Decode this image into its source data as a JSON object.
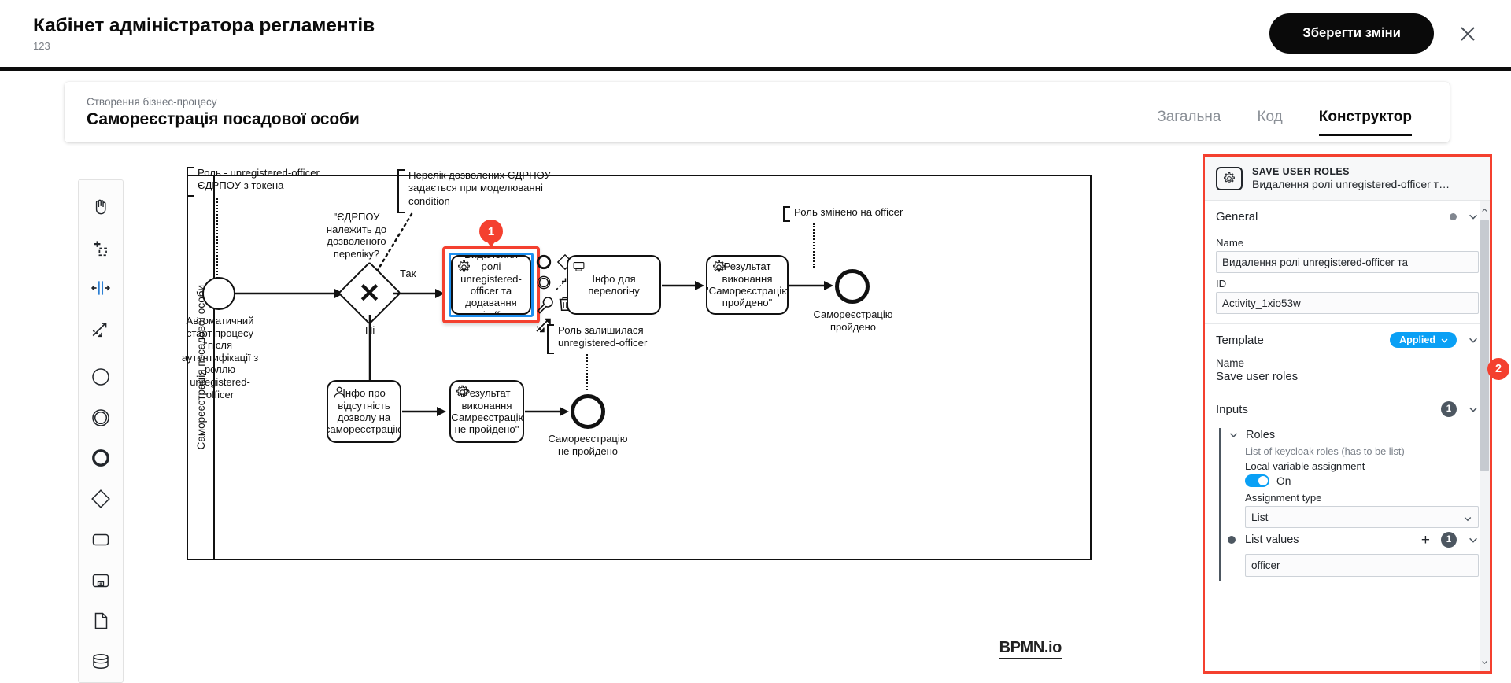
{
  "header": {
    "title": "Кабінет адміністратора регламентів",
    "subtitle": "123",
    "save_label": "Зберегти зміни",
    "close_icon": "close-icon"
  },
  "process_card": {
    "kicker": "Створення бізнес-процесу",
    "name": "Самореєстрація посадової особи",
    "tabs": [
      {
        "label": "Загальна",
        "active": false
      },
      {
        "label": "Код",
        "active": false
      },
      {
        "label": "Конструктор",
        "active": true
      }
    ]
  },
  "palette": {
    "items": [
      {
        "name": "hand-tool-icon",
        "label": "Hand tool"
      },
      {
        "name": "lasso-tool-icon",
        "label": "Lasso tool"
      },
      {
        "name": "space-tool-icon",
        "label": "Space tool"
      },
      {
        "name": "connect-tool-icon",
        "label": "Global connect tool"
      },
      {
        "name": "start-event-icon",
        "label": "Create StartEvent"
      },
      {
        "name": "intermediate-event-icon",
        "label": "Create Intermediate/Boundary event"
      },
      {
        "name": "end-event-icon",
        "label": "Create EndEvent"
      },
      {
        "name": "gateway-icon",
        "label": "Create Gateway"
      },
      {
        "name": "task-icon",
        "label": "Create Task"
      },
      {
        "name": "subprocess-icon",
        "label": "Create expanded SubProcess"
      },
      {
        "name": "data-object-icon",
        "label": "Create DataObjectReference"
      },
      {
        "name": "data-store-icon",
        "label": "Create DataStoreReference"
      }
    ]
  },
  "diagram": {
    "lane_label": "Самореєстрація посадової особи",
    "logo": "BPMN.io",
    "annotations": [
      {
        "id": "ann1",
        "text": "Роль - unregistered-officer\nЄДРПОУ з токена"
      },
      {
        "id": "ann2",
        "text": "Перелік дозволених ЄДРПОУ\nзадається при моделюванні\ncondition"
      },
      {
        "id": "ann3",
        "text": "Роль змінено на officer"
      },
      {
        "id": "ann4",
        "text": "Роль залишилася\nunregistered-officer"
      }
    ],
    "nodes": {
      "start_event_caption": "Автоматичний\nстарт процесу\nпісля\nаутентифікації з\nроллю\nunregistered-\nofficer",
      "gateway_label": "\"ЄДРПОУ\nналежить до\nдозволеного\nпереліку?",
      "flow_yes": "Так",
      "flow_no": "Ні",
      "task_selected": "Видалення ролі unregistered-officer та додавання ролі officer",
      "task_relogin": "Інфо для перелогіну",
      "task_result_ok": "Результат виконання \"Самореєстрацію пройдено\"",
      "task_no_permission": "Інфо про відсутність дозволу на самореєстрацію",
      "task_result_fail": "Результат виконання \"Самреєстрацію не пройдено\"",
      "end_ok_caption": "Самореєстрацію\nпройдено",
      "end_fail_caption": "Самореєстрацію\nне пройдено"
    },
    "marker_number": "1",
    "context_pad": [
      {
        "name": "append-end-event-icon"
      },
      {
        "name": "append-gateway-icon"
      },
      {
        "name": "append-task-icon"
      },
      {
        "name": "append-intermediate-event-icon"
      },
      {
        "name": "append-text-annotation-icon"
      },
      {
        "name": "wrench-icon"
      },
      {
        "name": "trash-icon"
      },
      {
        "name": "connect-icon"
      }
    ]
  },
  "properties_panel": {
    "marker_number": "2",
    "header": {
      "icon": "service-task-gear-icon",
      "title": "SAVE USER ROLES",
      "subtitle": "Видалення ролі unregistered-officer т…"
    },
    "general": {
      "group_title": "General",
      "name_label": "Name",
      "name_value": "Видалення ролі unregistered-officer та",
      "id_label": "ID",
      "id_value": "Activity_1xio53w"
    },
    "template": {
      "group_title": "Template",
      "badge": "Applied",
      "name_label": "Name",
      "name_value": "Save user roles"
    },
    "inputs": {
      "group_title": "Inputs",
      "count": "1",
      "entry_title": "Roles",
      "entry_desc": "List of keycloak roles (has to be list)",
      "local_var_label": "Local variable assignment",
      "toggle_state": "On",
      "assignment_type_label": "Assignment type",
      "assignment_type_value": "List",
      "assignment_type_options": [
        "List"
      ],
      "list_values_label": "List values",
      "list_values_count": "1",
      "list_values": [
        "officer"
      ]
    }
  },
  "colors": {
    "accent_red": "#f4402f",
    "accent_blue": "#1d8ff0",
    "badge_blue": "#0aa0f5",
    "badge_gray": "#4d5761"
  }
}
